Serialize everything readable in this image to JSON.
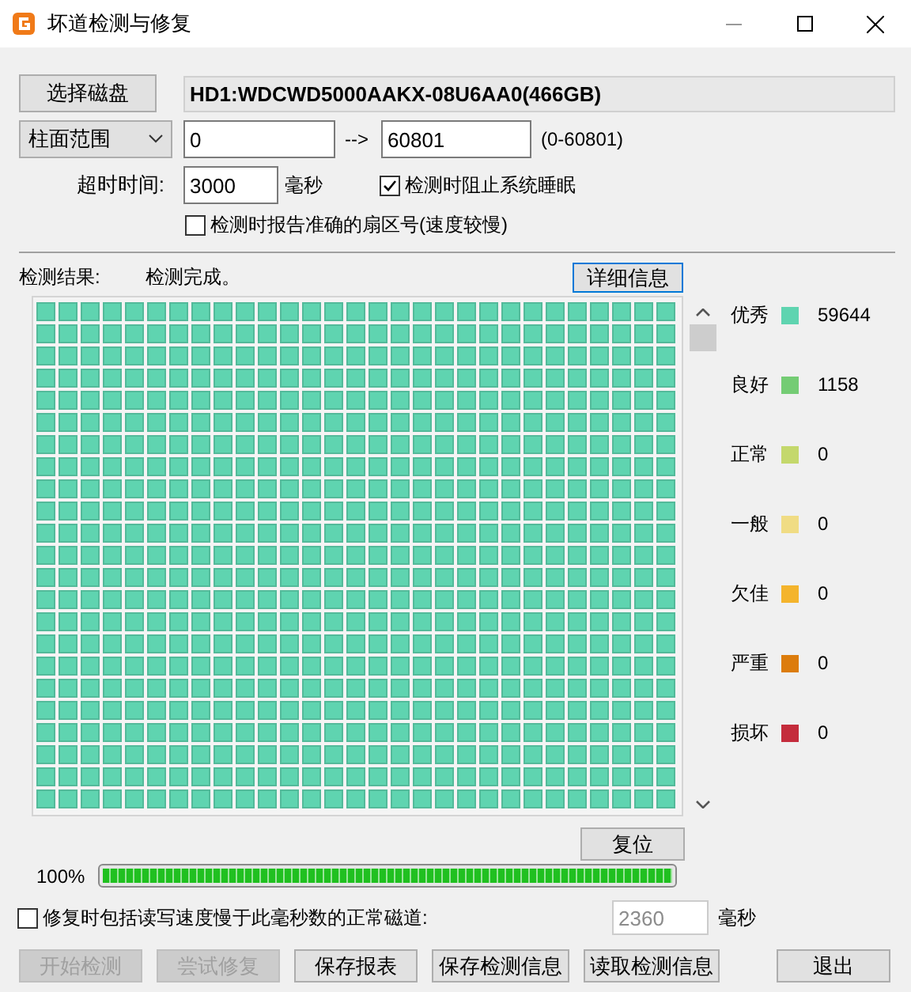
{
  "window": {
    "title": "坏道检测与修复"
  },
  "disk": {
    "button": "选择磁盘",
    "name": "HD1:WDCWD5000AAKX-08U6AA0(466GB)"
  },
  "range": {
    "mode": "柱面范围",
    "from": "0",
    "arrow": "-->",
    "to": "60801",
    "hint": "(0-60801)"
  },
  "timeout": {
    "label": "超时时间:",
    "value": "3000",
    "unit": "毫秒"
  },
  "options": [
    {
      "label": "检测时阻止系统睡眠",
      "checked": true
    },
    {
      "label": "检测时报告准确的扇区号(速度较慢)",
      "checked": false
    }
  ],
  "result": {
    "label": "检测结果:",
    "status": "检测完成。",
    "details_button": "详细信息"
  },
  "legend": [
    {
      "label": "优秀",
      "color": "#5fd4b0",
      "count": "59644"
    },
    {
      "label": "良好",
      "color": "#74cc74",
      "count": "1158"
    },
    {
      "label": "正常",
      "color": "#c4d86c",
      "count": "0"
    },
    {
      "label": "一般",
      "color": "#f0dc84",
      "count": "0"
    },
    {
      "label": "欠佳",
      "color": "#f4b42c",
      "count": "0"
    },
    {
      "label": "严重",
      "color": "#dc7c0c",
      "count": "0"
    },
    {
      "label": "损坏",
      "color": "#c42c3c",
      "count": "0"
    }
  ],
  "reset_button": "复位",
  "progress": {
    "reading": "100%",
    "level": 1
  },
  "repair_option": {
    "label": "修复时包括读写速度慢于此毫秒数的正常磁道:",
    "checked": false,
    "value": "2360",
    "unit": "毫秒",
    "disabled": true
  },
  "buttons": [
    {
      "label": "开始检测",
      "disabled": true
    },
    {
      "label": "尝试修复",
      "disabled": true
    },
    {
      "label": "保存报表",
      "disabled": false
    },
    {
      "label": "保存检测信息",
      "disabled": false
    },
    {
      "label": "读取检测信息",
      "disabled": false
    },
    {
      "label": "退出",
      "disabled": false
    }
  ]
}
